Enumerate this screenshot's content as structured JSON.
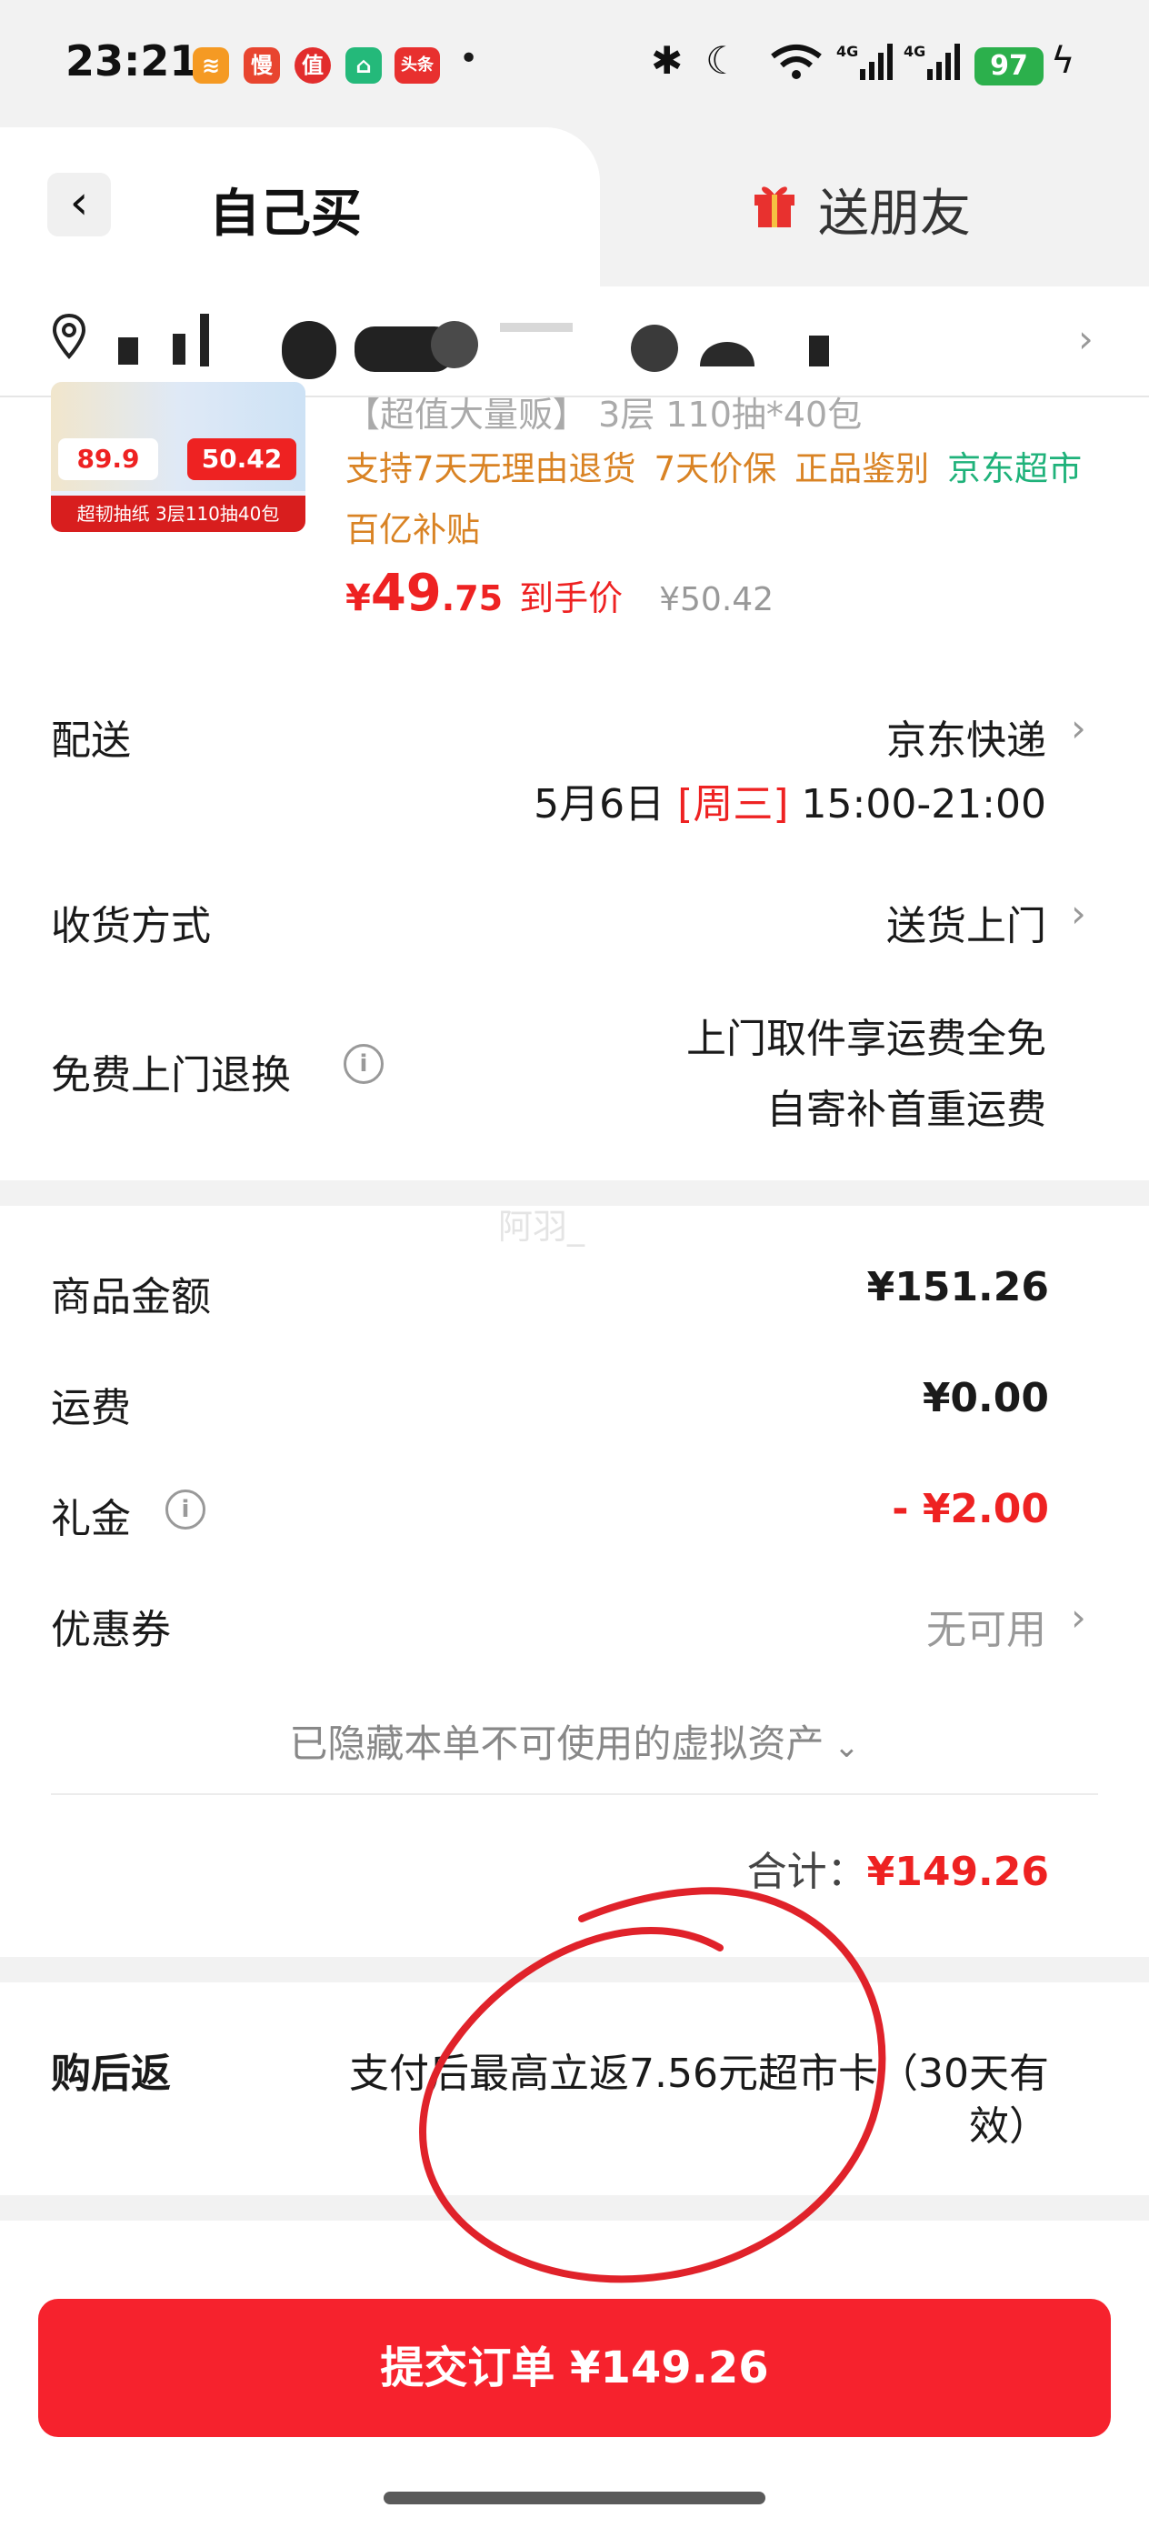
{
  "status_bar": {
    "time": "23:21",
    "apps": [
      {
        "icon": "stack-app-icon",
        "text": "",
        "color": "#f59a23"
      },
      {
        "icon": "slow-app-icon",
        "text": "慢",
        "color": "#e8452f"
      },
      {
        "icon": "value-app-icon",
        "text": "值",
        "color": "#e22d2d"
      },
      {
        "icon": "house-app-icon",
        "text": "",
        "color": "#24b97a"
      },
      {
        "icon": "toutiao-app-icon",
        "text": "头条",
        "color": "#e8302f"
      }
    ],
    "battery": "97"
  },
  "tabs": {
    "self": "自己买",
    "friend": "送朋友"
  },
  "product": {
    "title": "【超值大量贩】 3层 110抽*40包",
    "promos": [
      "支持7天无理由退货",
      "7天价保",
      "正品鉴别"
    ],
    "promo_green": "京东超市",
    "promo_line2": "百亿补贴",
    "price_symbol": "¥",
    "price_int": "49",
    "price_dec": ".75",
    "price_label": "到手价",
    "price_original": "¥50.42",
    "thumb": {
      "price1": "89.9",
      "price2": "50.42",
      "caption": "超韧抽纸 3层110抽40包"
    }
  },
  "delivery": {
    "label": "配送",
    "value": "京东快递",
    "date": "5月6日",
    "weekday": "[周三]",
    "time": "15:00-21:00"
  },
  "receive": {
    "label": "收货方式",
    "value": "送货上门"
  },
  "free_return": {
    "label": "免费上门退换",
    "line1": "上门取件享运费全免",
    "line2": "自寄补首重运费"
  },
  "watermark": "阿羽_",
  "summary": {
    "goods_label": "商品金额",
    "goods_value": "¥151.26",
    "shipping_label": "运费",
    "shipping_value": "¥0.00",
    "gift_label": "礼金",
    "gift_value": "- ¥2.00",
    "coupon_label": "优惠券",
    "coupon_value": "无可用",
    "hidden_assets": "已隐藏本单不可使用的虚拟资产",
    "total_label": "合计：",
    "total_value": "¥149.26"
  },
  "rebate": {
    "label": "购后返",
    "line1": "支付后最高立返7.56元超市卡（30天有",
    "line2": "效）"
  },
  "submit": {
    "label": "提交订单 ¥149.26"
  },
  "colors": {
    "accent_red": "#f6222d",
    "promo_orange": "#d98324",
    "promo_green": "#1fb27a",
    "annotation_red": "#e0222a"
  }
}
